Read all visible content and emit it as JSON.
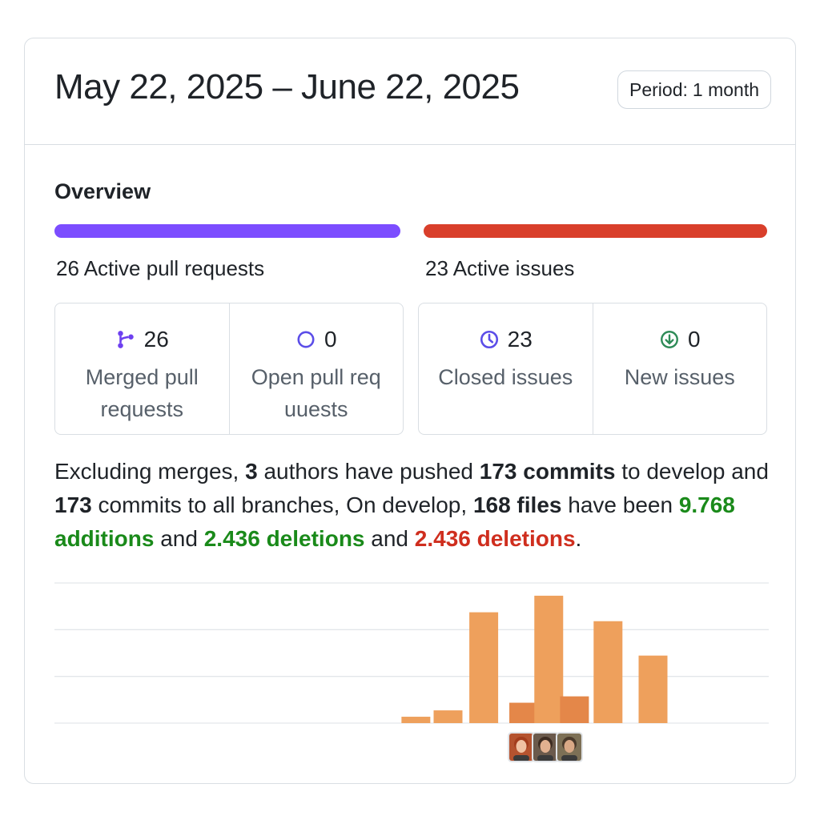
{
  "header": {
    "title": "May 22, 2025 – June 22, 2025",
    "period_prefix": "Period:",
    "period_value": "1 month"
  },
  "overview": {
    "title": "Overview",
    "pull_requests": {
      "summary": "26 Active pull requests",
      "bar_color": "#7c4dff",
      "merged": {
        "count": "26",
        "label": "Merged pull requests",
        "icon": "git-merge-icon"
      },
      "open": {
        "count": "0",
        "label": "Open pull req uuests",
        "icon": "circle-open-icon"
      }
    },
    "issues": {
      "summary": "23 Active issues",
      "bar_color": "#d93f2b",
      "closed": {
        "count": "23",
        "label": "Closed issues",
        "icon": "clock-icon"
      },
      "new": {
        "count": "0",
        "label": "New issues",
        "icon": "arrow-down-circle-icon"
      }
    }
  },
  "description": {
    "t1": "Excluding merges, ",
    "authors": "3",
    "t2": " authors have pushed ",
    "commits_develop": "173 commits",
    "t3": " to develop and ",
    "commits_all": "173",
    "t4": " commits to all branches, On develop, ",
    "files": "168 files",
    "t5": " have been ",
    "additions": "9.768 additions",
    "t6": " and ",
    "deletions_green": "2.436 deletions",
    "t7": " and ",
    "deletions_red": "2.436 deletions",
    "t8": "."
  },
  "colors": {
    "bar_main": "#eea05c",
    "bar_dark": "#e48749",
    "grid": "#e3e6ea"
  },
  "chart_data": {
    "type": "bar",
    "bars": [
      {
        "x": 0.506,
        "value": 0.05,
        "shade": "main"
      },
      {
        "x": 0.551,
        "value": 0.1,
        "shade": "main"
      },
      {
        "x": 0.601,
        "value": 0.87,
        "shade": "main"
      },
      {
        "x": 0.657,
        "value": 0.16,
        "shade": "dark"
      },
      {
        "x": 0.692,
        "value": 1.0,
        "shade": "main"
      },
      {
        "x": 0.728,
        "value": 0.21,
        "shade": "dark"
      },
      {
        "x": 0.775,
        "value": 0.8,
        "shade": "main"
      },
      {
        "x": 0.838,
        "value": 0.53,
        "shade": "main"
      }
    ],
    "ylim": [
      0,
      1.1
    ],
    "gridlines": 3
  },
  "avatars": [
    {
      "name": "avatar-1",
      "bg": "#b5532f",
      "face": "#f0c2a3",
      "hair": "#a33d1d"
    },
    {
      "name": "avatar-2",
      "bg": "#6b5a4c",
      "face": "#e2b190",
      "hair": "#3d2c22"
    },
    {
      "name": "avatar-3",
      "bg": "#7d7056",
      "face": "#d9a886",
      "hair": "#4a3a2c"
    }
  ]
}
